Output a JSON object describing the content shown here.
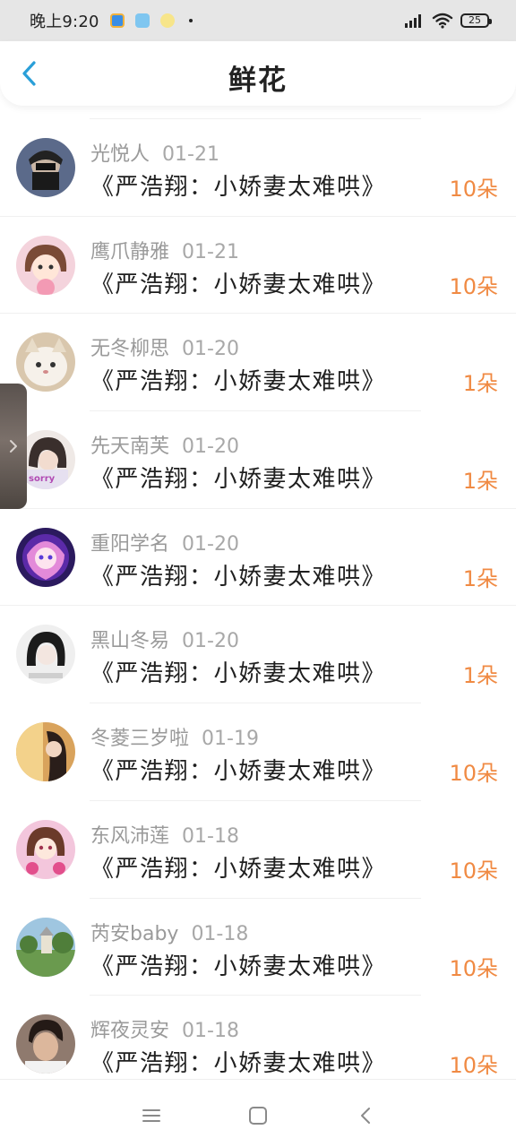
{
  "status_bar": {
    "time": "晚上9:20",
    "battery": "25"
  },
  "header": {
    "title": "鲜花"
  },
  "list": [
    {
      "name": "光悦人",
      "date": "01-21",
      "book": "《严浩翔：小娇妻太难哄》",
      "count": "10朵"
    },
    {
      "name": "鹰爪静雅",
      "date": "01-21",
      "book": "《严浩翔：小娇妻太难哄》",
      "count": "10朵"
    },
    {
      "name": "无冬柳思",
      "date": "01-20",
      "book": "《严浩翔：小娇妻太难哄》",
      "count": "1朵"
    },
    {
      "name": "先天南芙",
      "date": "01-20",
      "book": "《严浩翔：小娇妻太难哄》",
      "count": "1朵"
    },
    {
      "name": "重阳学名",
      "date": "01-20",
      "book": "《严浩翔：小娇妻太难哄》",
      "count": "1朵"
    },
    {
      "name": "黑山冬易",
      "date": "01-20",
      "book": "《严浩翔：小娇妻太难哄》",
      "count": "1朵"
    },
    {
      "name": "冬菱三岁啦",
      "date": "01-19",
      "book": "《严浩翔：小娇妻太难哄》",
      "count": "10朵"
    },
    {
      "name": "东风沛莲",
      "date": "01-18",
      "book": "《严浩翔：小娇妻太难哄》",
      "count": "10朵"
    },
    {
      "name": "芮安baby",
      "date": "01-18",
      "book": "《严浩翔：小娇妻太难哄》",
      "count": "10朵"
    },
    {
      "name": "辉夜灵安",
      "date": "01-18",
      "book": "《严浩翔：小娇妻太难哄》",
      "count": "10朵"
    }
  ],
  "colors": {
    "accent_blue": "#2a9fd8",
    "count_orange": "#f08a43",
    "name_gray": "#9a9a9a"
  },
  "icons": {
    "back": "chevron-left-icon",
    "side_handle": "chevron-right-icon",
    "nav_menu": "menu-icon",
    "nav_home": "home-square-icon",
    "nav_back": "back-icon"
  }
}
